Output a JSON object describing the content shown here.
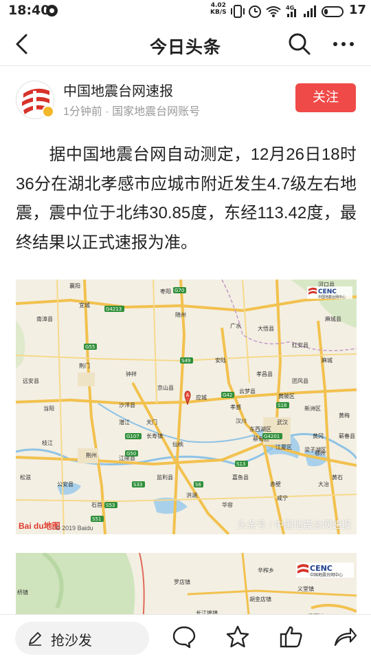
{
  "status_bar": {
    "time": "18:40",
    "net_speed_value": "4.02",
    "net_speed_unit": "KB/S",
    "network_type": "4G",
    "battery_level": "17"
  },
  "nav": {
    "title": "今日头条",
    "icons": [
      "back-arrow-icon",
      "search-icon",
      "more-icon"
    ]
  },
  "author": {
    "name": "中国地震台网速报",
    "meta": "1分钟前 · 国家地震台网账号",
    "follow_label": "关注",
    "follow_color": "#f04a48"
  },
  "article": {
    "text": "据中国地震台网自动测定，12月26日18时36分在湖北孝感市应城市附近发生4.7级左右地震，震中位于北纬30.85度，东经113.42度，最终结果以正式速报为准。"
  },
  "map1": {
    "logo_text": "CENC",
    "logo_sub": "中国地震台网中心",
    "marker_label": "A",
    "watermark": "头条号 / 中国地震台网速报",
    "baidu_logo": "Bai du地图",
    "copyright": "© 2019 Baidu",
    "places": [
      "襄阳",
      "随州",
      "广水",
      "大悟县",
      "荆门",
      "京山县",
      "应城",
      "孝感",
      "孝昌县",
      "安陆",
      "云梦县",
      "黄陂区",
      "天门",
      "潜江",
      "仙桃",
      "武汉",
      "汉川",
      "蔡甸区",
      "江夏区",
      "咸宁",
      "荆州",
      "江陵县",
      "石首",
      "监利县",
      "洪湖",
      "嘉鱼县",
      "赤壁",
      "鄂州",
      "黄冈",
      "黄石",
      "团风县",
      "新洲区",
      "麻城",
      "红安县",
      "大冶",
      "宜城",
      "南漳县",
      "远安县",
      "当阳",
      "枝江",
      "松滋",
      "公安县",
      "沙洋县",
      "钟祥",
      "长寿镇",
      "枣阳",
      "河口县",
      "麻城县",
      "华容",
      "东西湖区",
      "梁子湖区",
      "黄梅",
      "蕲春县"
    ],
    "roads": [
      "G70",
      "G4213",
      "G55",
      "G42",
      "G4201",
      "G50",
      "G107",
      "S18",
      "S49",
      "S6",
      "S13",
      "S33",
      "S53",
      "S51"
    ]
  },
  "map2": {
    "logo_text": "CENC",
    "logo_sub": "中国地震台网中心",
    "places": [
      "桥镇",
      "罗店镇",
      "辛榨乡",
      "义堂镇",
      "胡金店镇",
      "长江埠镇",
      "杨河镇"
    ]
  },
  "bottom_bar": {
    "comment_label": "抢沙发",
    "icons": [
      "pen-icon",
      "comment-icon",
      "favorite-star-icon",
      "like-thumb-icon",
      "share-icon"
    ]
  }
}
